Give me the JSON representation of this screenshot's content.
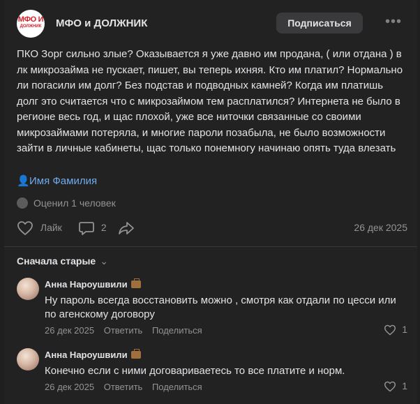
{
  "group": {
    "logo_line1": "МФО И",
    "logo_line2": "ДОЛЖНИК",
    "name": "МФО и ДОЛЖНИК",
    "subscribe_label": "Подписаться",
    "more_label": "•••"
  },
  "post": {
    "text": "ПКО Зорг сильно злые? Оказывается я уже давно им продана, ( или отдана ) в лк микрозайма не пускает, пишет, вы теперь ихняя. Кто им платил? Нормально ли погасили им долг? Без подстав и подводных камней? Когда им платишь долг это считается что с микрозаймом тем расплатился? Интернета не было в регионе весь год, и щас плохой, уже все ниточки связанные со своими микрозаймами потеряла, и многие пароли позабыла, не было возможности зайти в личные кабинеты, щас только понемногу начинаю опять туда влезать",
    "author_icon": "👤",
    "author_link": "Имя Фамилия",
    "rated": "Оценил 1 человек",
    "like_label": "Лайк",
    "comments_count": "2",
    "date": "26 дек 2025"
  },
  "comments_section": {
    "sort_label": "Сначала старые",
    "sort_icon": "⌄"
  },
  "comments": [
    {
      "author": "Анна Нароушвили",
      "text": "Ну пароль всегда восстановить можно , смотря как отдали по цесси или по агенскому договору",
      "date": "26 дек 2025",
      "reply": "Ответить",
      "share": "Поделиться",
      "likes": "1"
    },
    {
      "author": "Анна Нароушвили",
      "text": "Конечно если с ними договариваетесь то все платите и норм.",
      "date": "26 дек 2025",
      "reply": "Ответить",
      "share": "Поделиться",
      "likes": "1"
    }
  ]
}
